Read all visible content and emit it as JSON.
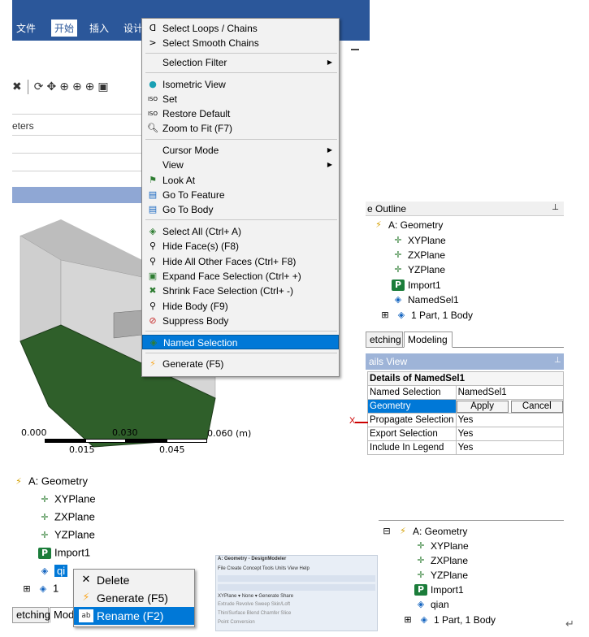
{
  "ribbon": {
    "tabs": [
      "文件",
      "开始",
      "插入",
      "设计"
    ],
    "active": "开始"
  },
  "toolbar": {
    "params_label": "eters"
  },
  "context_menu": {
    "items": [
      {
        "label": "Select Loops / Chains",
        "icon": "loop-select-icon"
      },
      {
        "label": "Select Smooth Chains",
        "icon": "chain-select-icon"
      },
      {
        "label": "Selection Filter",
        "submenu": true
      },
      {
        "label": "Isometric View",
        "icon": "isometric-sphere-icon"
      },
      {
        "label": "Set",
        "icon": "iso-set-icon"
      },
      {
        "label": "Restore Default",
        "icon": "iso-restore-icon"
      },
      {
        "label": "Zoom to Fit (F7)",
        "icon": "zoom-fit-icon"
      },
      {
        "label": "Cursor Mode",
        "submenu": true
      },
      {
        "label": "View",
        "submenu": true
      },
      {
        "label": "Look At",
        "icon": "look-at-icon"
      },
      {
        "label": "Go To Feature",
        "icon": "go-to-feature-icon"
      },
      {
        "label": "Go To Body",
        "icon": "go-to-body-icon"
      },
      {
        "label": "Select All (Ctrl+ A)",
        "icon": "select-all-icon"
      },
      {
        "label": "Hide Face(s) (F8)",
        "icon": "hide-face-icon"
      },
      {
        "label": "Hide All Other Faces (Ctrl+ F8)",
        "icon": "hide-other-faces-icon"
      },
      {
        "label": "Expand Face Selection (Ctrl+ +)",
        "icon": "expand-selection-icon"
      },
      {
        "label": "Shrink Face Selection (Ctrl+ -)",
        "icon": "shrink-selection-icon"
      },
      {
        "label": "Hide Body (F9)",
        "icon": "hide-body-icon"
      },
      {
        "label": "Suppress Body",
        "icon": "suppress-body-icon"
      },
      {
        "label": "Named Selection",
        "icon": "named-selection-icon",
        "highlighted": true
      },
      {
        "label": "Generate (F5)",
        "icon": "generate-lightning-icon"
      }
    ]
  },
  "scale": {
    "top": [
      "0.000",
      "0.030",
      "0.060 (m)"
    ],
    "bottom": [
      "0.015",
      "0.045"
    ]
  },
  "outline": {
    "title": "e Outline",
    "root": "A: Geometry",
    "items": [
      "XYPlane",
      "ZXPlane",
      "YZPlane",
      "Import1",
      "NamedSel1",
      "1 Part, 1 Body"
    ],
    "tabs": [
      "etching",
      "Modeling"
    ]
  },
  "details": {
    "title": "ails View",
    "header": "Details of NamedSel1",
    "rows": [
      {
        "k": "Named Selection",
        "v": "NamedSel1"
      },
      {
        "k": "Geometry",
        "v": "",
        "apply": "Apply",
        "cancel": "Cancel"
      },
      {
        "k": "Propagate Selection",
        "v": "Yes"
      },
      {
        "k": "Export Selection",
        "v": "Yes"
      },
      {
        "k": "Include In Legend",
        "v": "Yes"
      }
    ],
    "axis_marker": "X"
  },
  "tree2": {
    "root": "A: Geometry",
    "items": [
      "XYPlane",
      "ZXPlane",
      "YZPlane",
      "Import1",
      "qi",
      "1"
    ],
    "tabs": [
      "etching",
      "Mod"
    ]
  },
  "menu2": {
    "items": [
      {
        "label": "Delete",
        "icon": "delete-x-icon"
      },
      {
        "label": "Generate (F5)",
        "icon": "generate-lightning-icon"
      },
      {
        "label": "Rename (F2)",
        "icon": "rename-icon",
        "highlighted": true
      }
    ]
  },
  "dm": {
    "title": "A: Geometry - DesignModeler",
    "menu": "File  Create  Concept  Tools  Units  View  Help",
    "row3": "XYPlane   ▾  None   ▾  Generate  Share",
    "row4": "Extrude  Revolve  Sweep  Skin/Loft",
    "row5": "Thin/Surface  Blend  Chamfer  Slice",
    "row6": "Point  Conversion"
  },
  "tree3": {
    "root": "A: Geometry",
    "items": [
      "XYPlane",
      "ZXPlane",
      "YZPlane",
      "Import1",
      "qian",
      "1 Part, 1 Body"
    ]
  },
  "return_mark": "↵"
}
